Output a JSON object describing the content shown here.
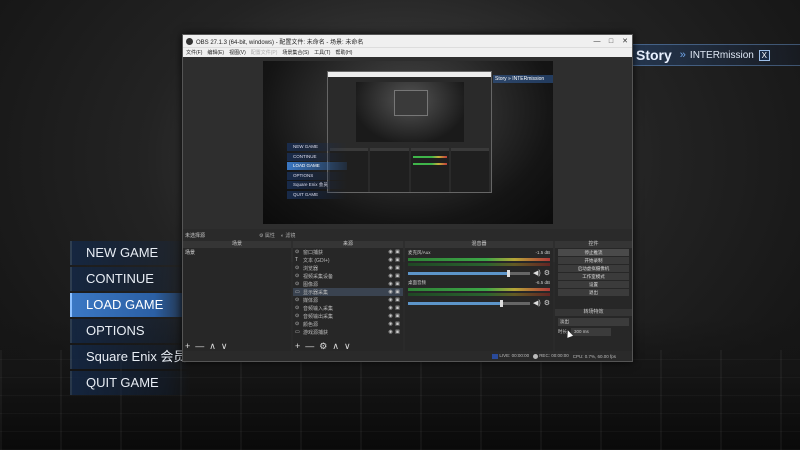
{
  "story_banner": {
    "title": "Story",
    "arrows": "»",
    "subtitle": "INTERmission",
    "close": "X"
  },
  "game_menu": {
    "items": [
      {
        "label": "NEW GAME"
      },
      {
        "label": "CONTINUE"
      },
      {
        "label": "LOAD GAME",
        "active": true
      },
      {
        "label": "OPTIONS"
      },
      {
        "label": "Square Enix 会员"
      },
      {
        "label": "QUIT GAME"
      }
    ]
  },
  "obs": {
    "title": "OBS 27.1.3 (64-bit, windows) - 配置文件: 未命名 - 场景: 未命名",
    "window_buttons": {
      "minimize": "—",
      "maximize": "□",
      "close": "✕"
    },
    "menu": [
      "文件(F)",
      "编辑(E)",
      "视图(V)",
      "配置文件(P)",
      "场景集合(S)",
      "工具(T)",
      "帮助(H)"
    ],
    "preview": {
      "nested_story": "Story » INTERmission",
      "mini_menu": [
        "NEW GAME",
        "CONTINUE",
        "LOAD GAME",
        "OPTIONS",
        "Square Enix 会员",
        "QUIT GAME"
      ]
    },
    "scene_status": {
      "label": "未选择源",
      "properties": "属性",
      "filters": "滤镜"
    },
    "docks": {
      "scenes": {
        "header": "场景",
        "items": [
          "场景"
        ]
      },
      "sources": {
        "header": "来源",
        "items": [
          {
            "icon": "⊙",
            "name": "窗口捕获"
          },
          {
            "icon": "T",
            "name": "文本 (GDI+)"
          },
          {
            "icon": "⊙",
            "name": "浏览器"
          },
          {
            "icon": "⊙",
            "name": "视频采集设备"
          },
          {
            "icon": "⊙",
            "name": "图像源"
          },
          {
            "icon": "▭",
            "name": "显示器采集",
            "selected": true
          },
          {
            "icon": "⊙",
            "name": "媒体源"
          },
          {
            "icon": "⊙",
            "name": "音频输入采集"
          },
          {
            "icon": "⊙",
            "name": "音频输出采集"
          },
          {
            "icon": "⊙",
            "name": "颜色源"
          },
          {
            "icon": "▭",
            "name": "游戏源捕获"
          }
        ],
        "footer": [
          "+",
          "—",
          "⚙",
          "∧",
          "∨"
        ]
      },
      "mixer": {
        "header": "混音器",
        "tracks": [
          {
            "name": "麦克风/Aux",
            "db": "-1.5 dB",
            "fader": 0.82
          },
          {
            "name": "桌面音频",
            "db": "-6.5 dB",
            "fader": 0.76
          }
        ]
      },
      "controls": {
        "header": "控件",
        "buttons": [
          "停止推流",
          "开始录制",
          "启动虚拟摄像机",
          "工作室模式",
          "设置",
          "退出"
        ],
        "transitions_header": "转场特效",
        "transition": "淡出",
        "duration_label": "时长",
        "duration_value": "300 ms"
      },
      "scenes_footer": [
        "+",
        "—",
        "∧",
        "∨"
      ]
    },
    "statusbar": {
      "live": "LIVE: 00:00:00",
      "rec": "REC: 00:00:00",
      "cpu": "CPU: 0.7%, 60.00 fps"
    }
  }
}
